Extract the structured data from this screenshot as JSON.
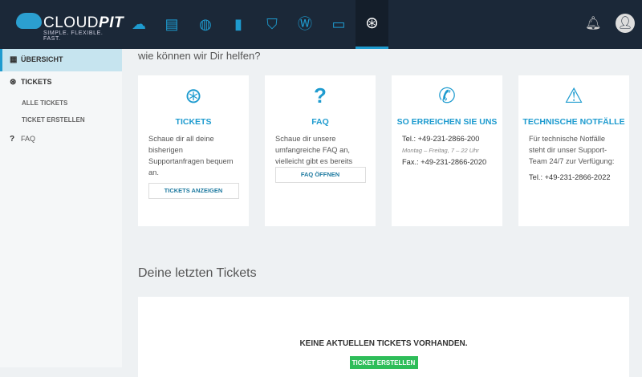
{
  "brand": {
    "name_light": "CLOUD",
    "name_bold": "PIT",
    "tagline": "SIMPLE. FLEXIBLE. FAST."
  },
  "topnav": [
    "cloud-icon",
    "server-invoice-icon",
    "network-globe-icon",
    "office-icon",
    "shield-icon",
    "wordpress-icon",
    "webpage-icon",
    "lifebuoy-icon"
  ],
  "sidebar": {
    "items": [
      {
        "label": "ÜBERSICHT"
      },
      {
        "label": "TICKETS"
      },
      {
        "label": "ALLE TICKETS"
      },
      {
        "label": "TICKET ERSTELLEN"
      },
      {
        "label": "FAQ"
      }
    ]
  },
  "main": {
    "help_heading": "wie können wir Dir helfen?",
    "cards": [
      {
        "title": "TICKETS",
        "text": "Schaue dir all deine bisherigen Supportanfragen bequem an.",
        "button": "TICKETS ANZEIGEN"
      },
      {
        "title": "FAQ",
        "text": "Schaue dir unsere umfangreiche FAQ an, vielleicht gibt es bereits eine unkomplizierte Lösung für",
        "button": "FAQ ÖFFNEN"
      },
      {
        "title": "SO ERREICHEN SIE UNS",
        "tel": "Tel.: +49-231-2866-200",
        "hours": "Montag – Freitag, 7 – 22 Uhr",
        "fax": "Fax.: +49-231-2866-2020"
      },
      {
        "title": "TECHNISCHE NOTFÄLLE",
        "text": "Für technische Notfälle steht dir unser Support-Team 24/7 zur Verfügung:",
        "tel": "Tel.: +49-231-2866-2022"
      }
    ],
    "recent_heading": "Deine letzten Tickets",
    "empty_text": "KEINE AKTUELLEN TICKETS VORHANDEN.",
    "create_button": "TICKET ERSTELLEN"
  },
  "colors": {
    "accent": "#1e9bcf",
    "topbar": "#1b2838",
    "success": "#2ebd59"
  }
}
